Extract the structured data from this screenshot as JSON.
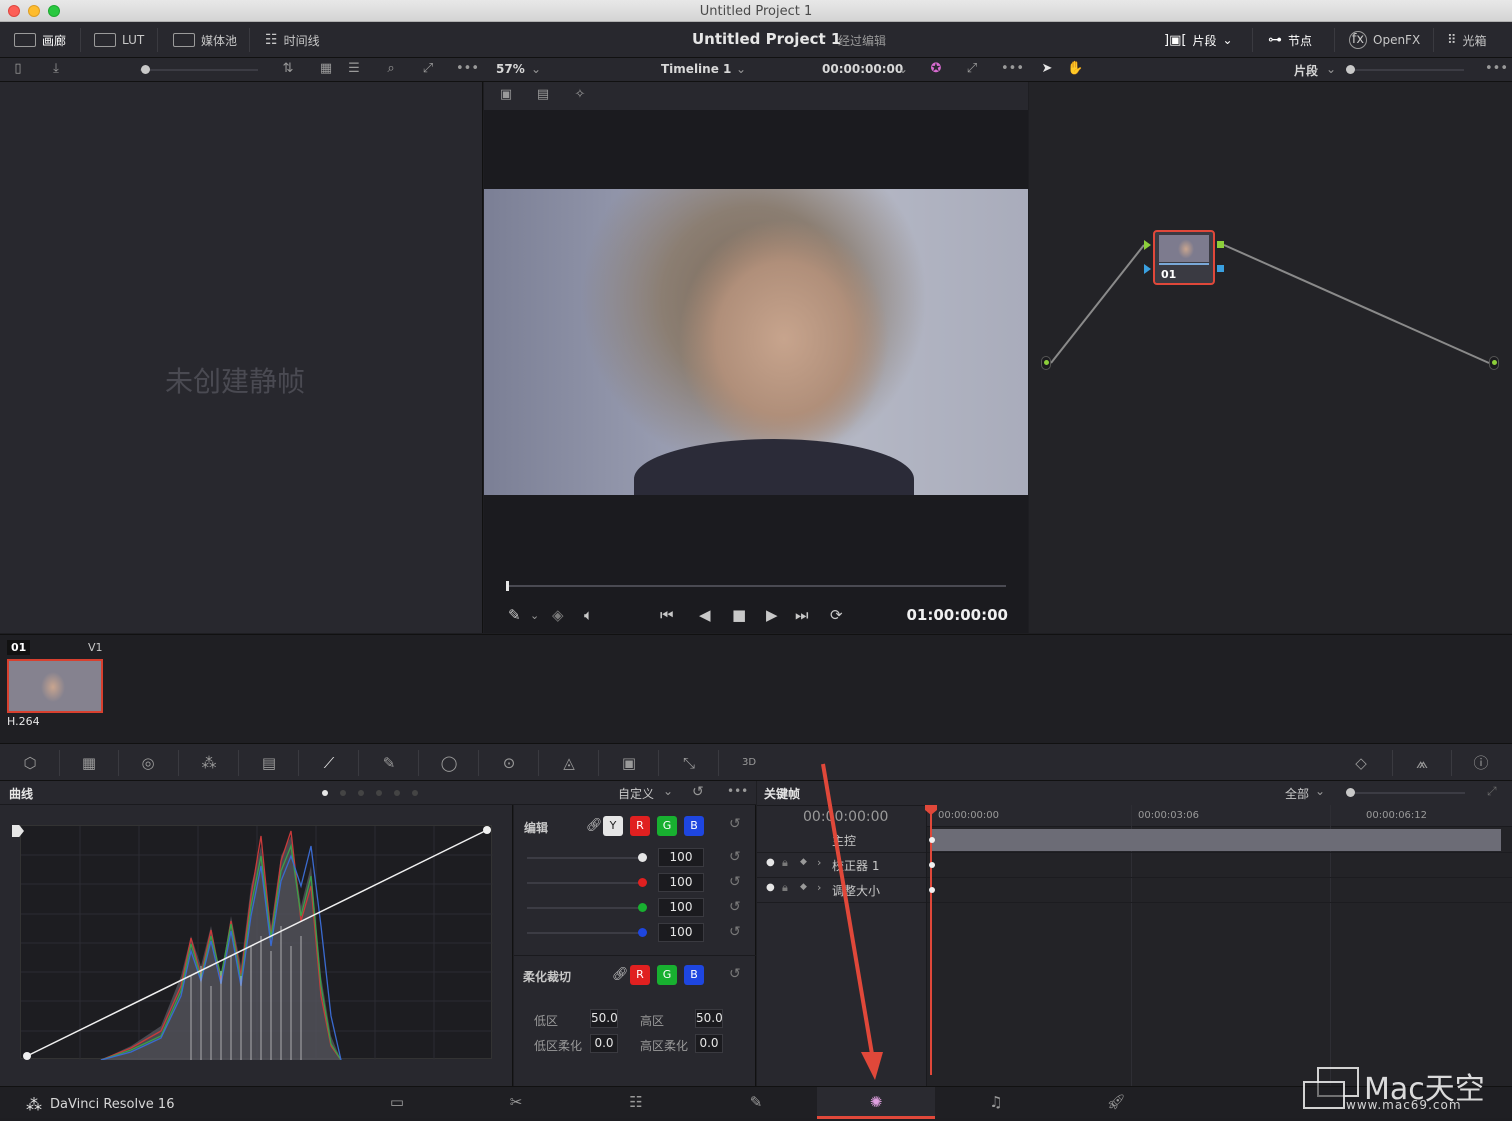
{
  "window": {
    "title": "Untitled Project 1"
  },
  "toolbar": {
    "gallery": "画廊",
    "lut": "LUT",
    "media_pool": "媒体池",
    "timeline": "时间线",
    "project_title": "Untitled Project 1",
    "project_sub": "经过编辑",
    "clip_mode": "片段",
    "nodes": "节点",
    "openfx": "OpenFX",
    "lightbox": "光箱"
  },
  "subbar": {
    "zoom": "57%",
    "timeline_name": "Timeline 1",
    "timecode": "00:00:00:00",
    "node_mode": "片段"
  },
  "gallery": {
    "empty_text": "未创建静帧"
  },
  "viewer": {
    "timecode": "01:00:00:00"
  },
  "node": {
    "label": "01"
  },
  "clip": {
    "index": "01",
    "track": "V1",
    "codec": "H.264"
  },
  "curves": {
    "title": "曲线",
    "mode": "自定义",
    "edit_label": "编辑",
    "channels": [
      "Y",
      "R",
      "G",
      "B"
    ],
    "values": [
      "100",
      "100",
      "100",
      "100"
    ],
    "soft_clip_label": "柔化裁切",
    "low_label": "低区",
    "low_value": "50.0",
    "high_label": "高区",
    "high_value": "50.0",
    "low_soft_label": "低区柔化",
    "low_soft_value": "0.0",
    "high_soft_label": "高区柔化",
    "high_soft_value": "0.0"
  },
  "keyframes": {
    "title": "关键帧",
    "filter": "全部",
    "timecode": "00:00:00:00",
    "ruler": [
      "00:00:00:00",
      "00:00:03:06",
      "00:00:06:12"
    ],
    "rows": [
      "主控",
      "校正器 1",
      "调整大小"
    ]
  },
  "bottom": {
    "app_name": "DaVinci Resolve 16"
  },
  "watermark": {
    "brand": "Mac天空",
    "url": "www.mac69.com"
  },
  "colors": {
    "accent_red": "#e0483a",
    "node_green": "#8ccf3a",
    "node_blue": "#3aa0e0"
  }
}
